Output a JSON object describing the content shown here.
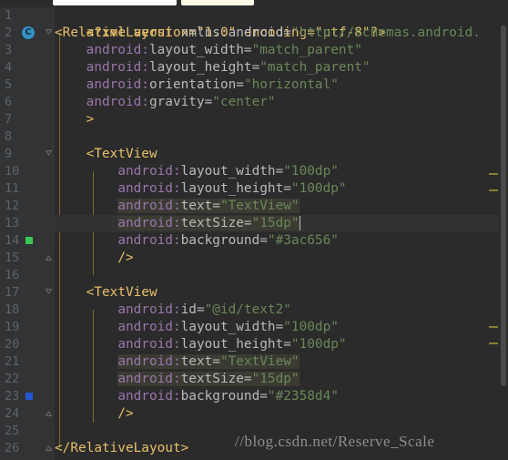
{
  "tabs": [
    {
      "label": ""
    },
    {
      "label": ""
    }
  ],
  "lines": [
    {
      "num": "1"
    },
    {
      "num": "2"
    },
    {
      "num": "3"
    },
    {
      "num": "4"
    },
    {
      "num": "5"
    },
    {
      "num": "6"
    },
    {
      "num": "7"
    },
    {
      "num": "8"
    },
    {
      "num": "9"
    },
    {
      "num": "10"
    },
    {
      "num": "11"
    },
    {
      "num": "12"
    },
    {
      "num": "13"
    },
    {
      "num": "14"
    },
    {
      "num": "15"
    },
    {
      "num": "16"
    },
    {
      "num": "17"
    },
    {
      "num": "18"
    },
    {
      "num": "19"
    },
    {
      "num": "20"
    },
    {
      "num": "21"
    },
    {
      "num": "22"
    },
    {
      "num": "23"
    },
    {
      "num": "24"
    },
    {
      "num": "25"
    },
    {
      "num": "26"
    }
  ],
  "code": {
    "l1_decl": "<?xml version=\"1.0\" encoding=\"utf-8\"?>",
    "l2_open": "<",
    "l2_tag": "RelativeLayout",
    "l2_attr": " xmlns:android=",
    "l2_val": "\"http://schemas.android.",
    "l3_ns": "android:",
    "l3_attr": "layout_width=",
    "l3_val": "\"match_parent\"",
    "l4_ns": "android:",
    "l4_attr": "layout_height=",
    "l4_val": "\"match_parent\"",
    "l5_ns": "android:",
    "l5_attr": "orientation=",
    "l5_val": "\"horizontal\"",
    "l6_ns": "android:",
    "l6_attr": "gravity=",
    "l6_val": "\"center\"",
    "l7_close": ">",
    "l9_open": "<",
    "l9_tag": "TextView",
    "l10_ns": "android:",
    "l10_attr": "layout_width=",
    "l10_val": "\"100dp\"",
    "l11_ns": "android:",
    "l11_attr": "layout_height=",
    "l11_val": "\"100dp\"",
    "l12_ns": "android:",
    "l12_attr": "text=",
    "l12_val": "\"TextView\"",
    "l13_ns": "android:",
    "l13_attr": "textSize=",
    "l13_val": "\"15dp\"",
    "l14_ns": "android:",
    "l14_attr": "background=",
    "l14_val": "\"#3ac656\"",
    "l15_close": "/>",
    "l17_open": "<",
    "l17_tag": "TextView",
    "l18_ns": "android:",
    "l18_attr": "id=",
    "l18_val": "\"@id/text2\"",
    "l19_ns": "android:",
    "l19_attr": "layout_width=",
    "l19_val": "\"100dp\"",
    "l20_ns": "android:",
    "l20_attr": "layout_height=",
    "l20_val": "\"100dp\"",
    "l21_ns": "android:",
    "l21_attr": "text=",
    "l21_val": "\"TextView\"",
    "l22_ns": "android:",
    "l22_attr": "textSize=",
    "l22_val": "\"15dp\"",
    "l23_ns": "android:",
    "l23_attr": "background=",
    "l23_val": "\"#2358d4\"",
    "l24_close": "/>",
    "l26_open": "</",
    "l26_tag": "RelativeLayout",
    "l26_close": ">"
  },
  "gutter_icons": {
    "class_badge": "C",
    "color_swatch_1": "#3ac656",
    "color_swatch_2": "#2358d4"
  },
  "watermark": "//blog.csdn.net/Reserve_Scale"
}
